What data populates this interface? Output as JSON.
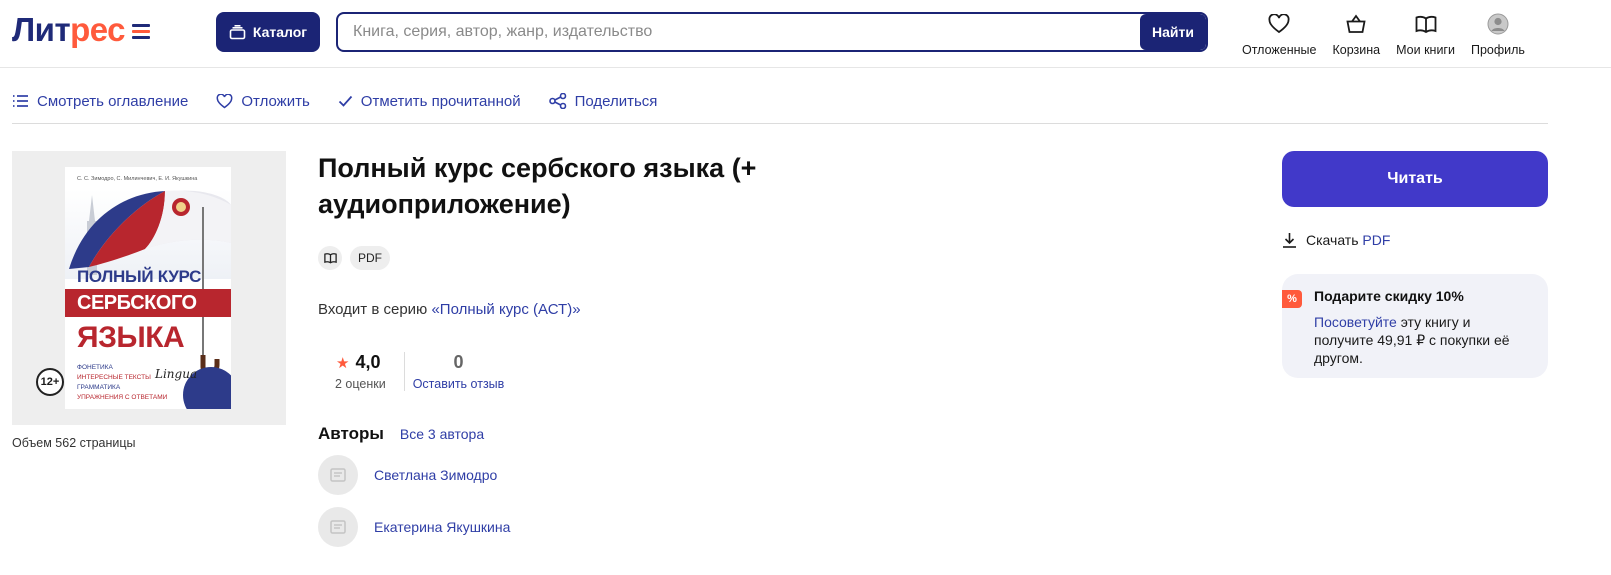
{
  "header": {
    "logo_part1": "Лит",
    "logo_part2": "рес",
    "catalog_label": "Каталог",
    "search_placeholder": "Книга, серия, автор, жанр, издательство",
    "search_button": "Найти",
    "actions": [
      {
        "icon": "heart-icon",
        "label": "Отложенные"
      },
      {
        "icon": "basket-icon",
        "label": "Корзина"
      },
      {
        "icon": "open-book-icon",
        "label": "Мои книги"
      },
      {
        "icon": "user-avatar-icon",
        "label": "Профиль"
      }
    ]
  },
  "toolbar": {
    "contents": "Смотреть оглавление",
    "postpone": "Отложить",
    "mark_read": "Отметить прочитанной",
    "share": "Поделиться"
  },
  "cover": {
    "authors": "С. С. Зимодро, С. Милинчевич, Е. И. Якушкина",
    "title_line1": "ПОЛНЫЙ КУРС",
    "title_line2": "СЕРБСКОГО",
    "title_line3": "ЯЗЫКА",
    "features": [
      "ФОНЕТИКА",
      "ИНТЕРЕСНЫЕ ТЕКСТЫ",
      "ГРАММАТИКА",
      "УПРАЖНЕНИЯ С ОТВЕТАМИ"
    ],
    "publisher": "Lingua",
    "age_rating": "12+"
  },
  "book": {
    "title": "Полный курс сербского языка (+ аудиоприложение)",
    "format_chip": "PDF",
    "series_prefix": "Входит в серию ",
    "series_name": "«Полный курс (АСТ)»",
    "volume": "Объем 562 страницы",
    "rating_value": "4,0",
    "rating_count": "2 оценки",
    "reviews_count": "0",
    "leave_review": "Оставить отзыв",
    "authors_heading": "Авторы",
    "all_authors": "Все 3 автора",
    "authors": [
      "Светлана Зимодро",
      "Екатерина Якушкина"
    ]
  },
  "sidebar": {
    "read_button": "Читать",
    "download_prefix": "Скачать ",
    "download_format": "PDF",
    "promo_badge": "%",
    "promo_title": "Подарите скидку 10%",
    "promo_link": "Посоветуйте",
    "promo_text": " эту книгу и получите 49,91 ₽ с покупки её другом."
  },
  "colors": {
    "brand_navy": "#1b2475",
    "brand_orange": "#ff5a3c",
    "link_blue": "#2f3ea6",
    "read_button": "#4139c9"
  }
}
